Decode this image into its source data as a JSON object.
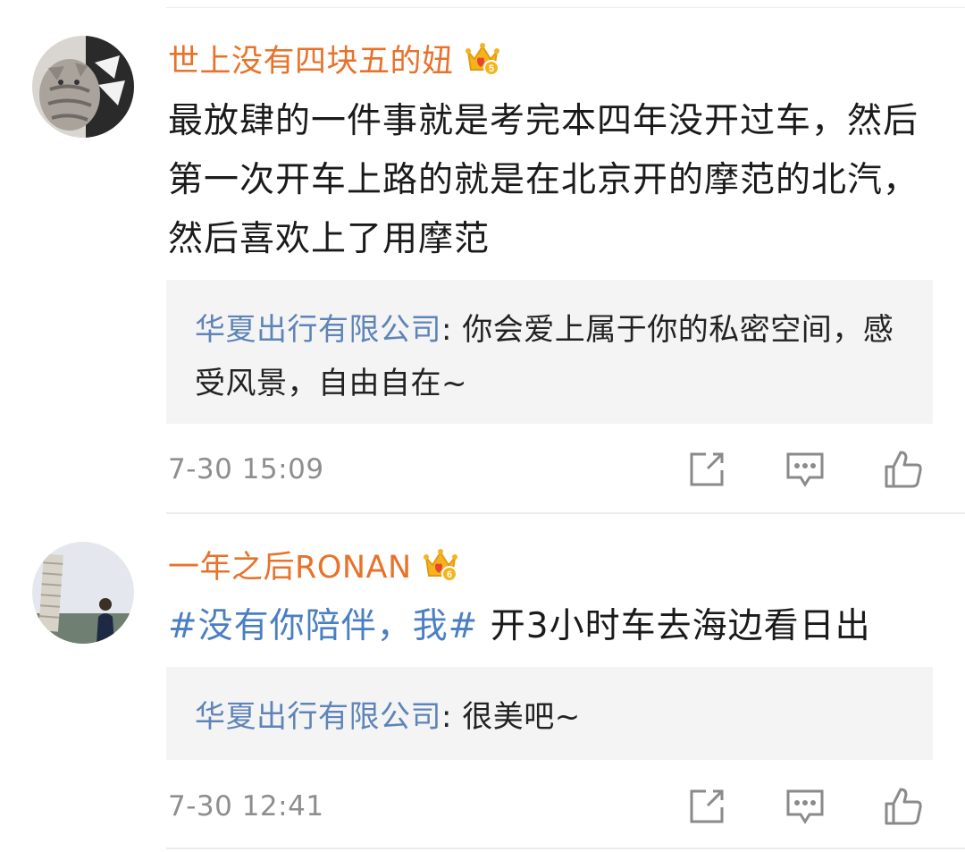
{
  "colors": {
    "username": "#e8722a",
    "topic": "#4a7fc1",
    "reply_author": "#5e84b8",
    "timestamp": "#8e8e8e"
  },
  "comments": [
    {
      "username": "世上没有四块五的妞",
      "crown_icon": "crown-level-icon",
      "crown_level": "5",
      "content": "最放肆的一件事就是考完本四年没开过车，然后第一次开车上路的就是在北京开的摩范的北汽，然后喜欢上了用摩范",
      "reply": {
        "author": "华夏出行有限公司",
        "separator": ": ",
        "text": "你会爱上属于你的私密空间，感受风景，自由自在~"
      },
      "timestamp": "7-30 15:09",
      "actions": [
        "share-icon",
        "comment-icon",
        "like-icon"
      ]
    },
    {
      "username": "一年之后RONAN",
      "crown_icon": "crown-level-icon",
      "crown_level": "6",
      "topic": "#没有你陪伴，我#",
      "content": " 开3小时车去海边看日出",
      "reply": {
        "author": "华夏出行有限公司",
        "separator": ": ",
        "text": "很美吧~"
      },
      "timestamp": "7-30 12:41",
      "actions": [
        "share-icon",
        "comment-icon",
        "like-icon"
      ]
    }
  ]
}
